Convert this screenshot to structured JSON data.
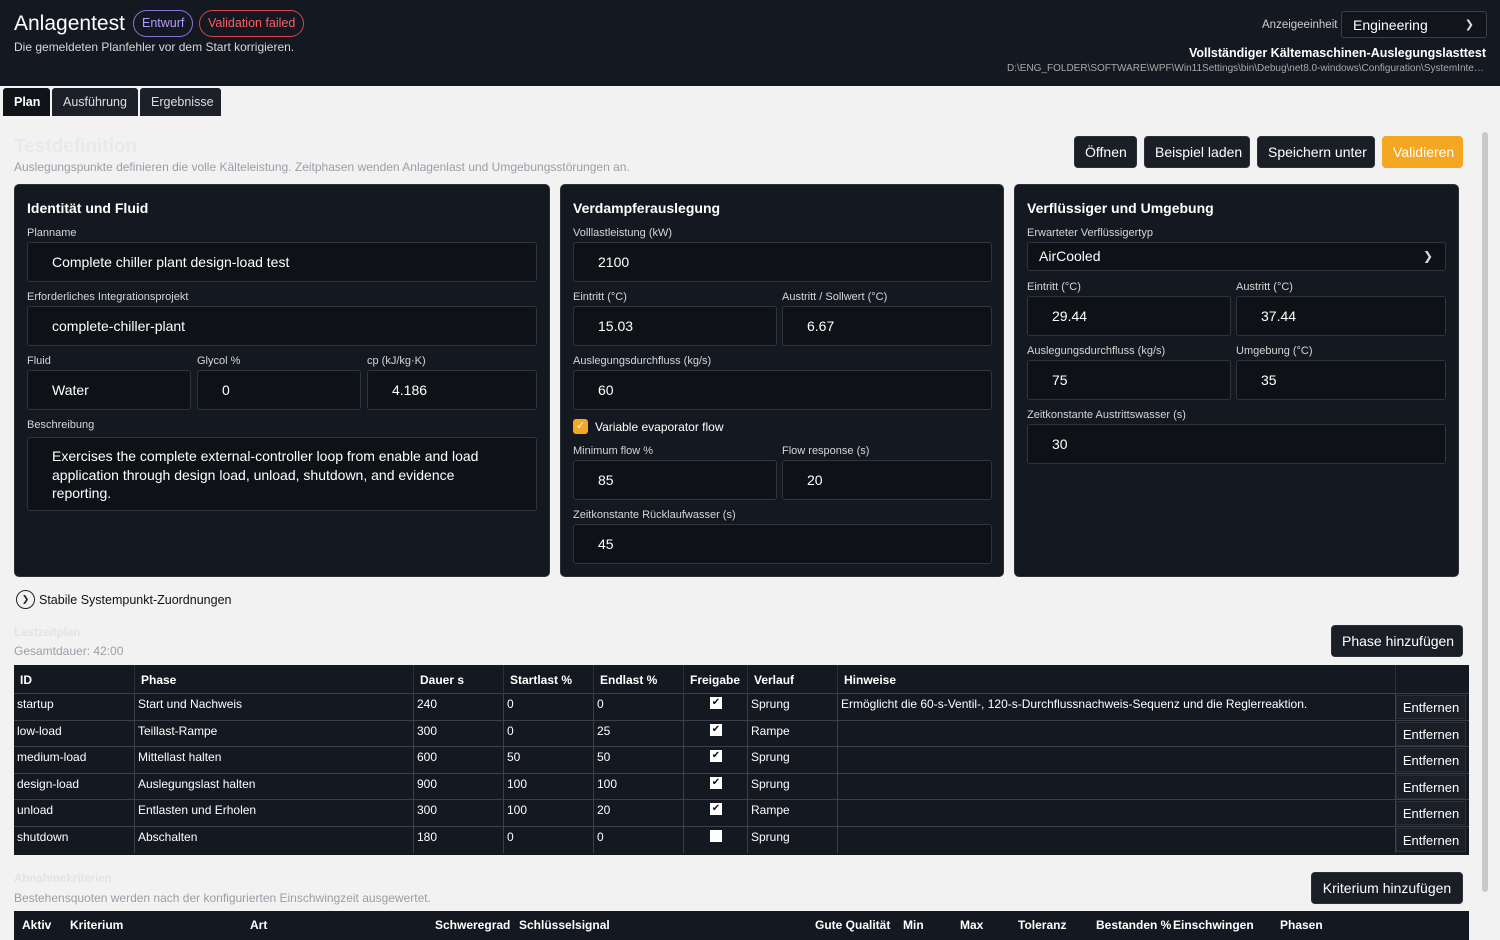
{
  "header": {
    "title": "Anlagentest",
    "badge_draft": "Entwurf",
    "badge_status": "Validation failed",
    "subtitle": "Die gemeldeten Planfehler vor dem Start korrigieren.",
    "unit_label": "Anzeigeeinheit",
    "unit_value": "Engineering",
    "test_title": "Vollständiger Kältemaschinen-Auslegungslasttest",
    "test_path": "D:\\ENG_FOLDER\\SOFTWARE\\WPF\\Win11Settings\\bin\\Debug\\net8.0-windows\\Configuration\\SystemIntegra..."
  },
  "tabs": [
    {
      "label": "Plan",
      "active": true
    },
    {
      "label": "Ausführung",
      "active": false
    },
    {
      "label": "Ergebnisse",
      "active": false
    }
  ],
  "definition": {
    "title": "Testdefinition",
    "description": "Auslegungspunkte definieren die volle Kälteleistung. Zeitphasen wenden Anlagenlast und Umgebungsstörungen an.",
    "buttons": {
      "open": "Öffnen",
      "load_example": "Beispiel laden",
      "save_as": "Speichern unter",
      "validate": "Validieren"
    }
  },
  "identity": {
    "title": "Identität und Fluid",
    "plan_name_label": "Planname",
    "plan_name": "Complete chiller plant design-load test",
    "project_label": "Erforderliches Integrationsprojekt",
    "project": "complete-chiller-plant",
    "fluid_label": "Fluid",
    "fluid": "Water",
    "glycol_label": "Glycol %",
    "glycol": "0",
    "cp_label": "cp (kJ/kg·K)",
    "cp": "4.186",
    "description_label": "Beschreibung",
    "description": "Exercises the complete external-controller loop from enable and load application through design load, unload, shutdown, and evidence reporting."
  },
  "evaporator": {
    "title": "Verdampferauslegung",
    "capacity_label": "Volllastleistung (kW)",
    "capacity": "2100",
    "inlet_label": "Eintritt (°C)",
    "inlet": "15.03",
    "outlet_label": "Austritt / Sollwert (°C)",
    "outlet": "6.67",
    "flow_label": "Auslegungsdurchfluss (kg/s)",
    "flow": "60",
    "variable_flow_label": "Variable evaporator flow",
    "variable_flow_checked": true,
    "min_flow_label": "Minimum flow %",
    "min_flow": "85",
    "flow_response_label": "Flow response (s)",
    "flow_response": "20",
    "return_tc_label": "Zeitkonstante Rücklaufwasser (s)",
    "return_tc": "45"
  },
  "condenser": {
    "title": "Verflüssiger und Umgebung",
    "type_label": "Erwarteter Verflüssigertyp",
    "type": "AirCooled",
    "inlet_label": "Eintritt (°C)",
    "inlet": "29.44",
    "outlet_label": "Austritt (°C)",
    "outlet": "37.44",
    "flow_label": "Auslegungsdurchfluss (kg/s)",
    "flow": "75",
    "ambient_label": "Umgebung (°C)",
    "ambient": "35",
    "leaving_tc_label": "Zeitkonstante Austrittswasser (s)",
    "leaving_tc": "30"
  },
  "mappings_label": "Stabile Systempunkt-Zuordnungen",
  "schedule": {
    "title": "Lastzeitplan",
    "total": "Gesamtdauer: 42:00",
    "add_button": "Phase hinzufügen",
    "columns": [
      "ID",
      "Phase",
      "Dauer s",
      "Startlast %",
      "Endlast %",
      "Freigabe",
      "Verlauf",
      "Hinweise"
    ],
    "remove_label": "Entfernen",
    "rows": [
      {
        "id": "startup",
        "phase": "Start und Nachweis",
        "duration": "240",
        "start": "0",
        "end": "0",
        "enable": true,
        "profile": "Sprung",
        "notes": "Ermöglicht die 60-s-Ventil-, 120-s-Durchflussnachweis-Sequenz und die Reglerreaktion."
      },
      {
        "id": "low-load",
        "phase": "Teillast-Rampe",
        "duration": "300",
        "start": "0",
        "end": "25",
        "enable": true,
        "profile": "Rampe",
        "notes": ""
      },
      {
        "id": "medium-load",
        "phase": "Mittellast halten",
        "duration": "600",
        "start": "50",
        "end": "50",
        "enable": true,
        "profile": "Sprung",
        "notes": ""
      },
      {
        "id": "design-load",
        "phase": "Auslegungslast halten",
        "duration": "900",
        "start": "100",
        "end": "100",
        "enable": true,
        "profile": "Sprung",
        "notes": ""
      },
      {
        "id": "unload",
        "phase": "Entlasten und Erholen",
        "duration": "300",
        "start": "100",
        "end": "20",
        "enable": true,
        "profile": "Rampe",
        "notes": ""
      },
      {
        "id": "shutdown",
        "phase": "Abschalten",
        "duration": "180",
        "start": "0",
        "end": "0",
        "enable": false,
        "profile": "Sprung",
        "notes": ""
      }
    ]
  },
  "criteria": {
    "title": "Abnahmekriterien",
    "description": "Bestehensquoten werden nach der konfigurierten Einschwingzeit ausgewertet.",
    "add_button": "Kriterium hinzufügen",
    "columns": [
      "Aktiv",
      "Kriterium",
      "Art",
      "Schweregrad",
      "Schlüsselsignal",
      "Gute Qualität",
      "Min",
      "Max",
      "Toleranz",
      "Bestanden %",
      "Einschwingen",
      "Phasen"
    ]
  },
  "colors": {
    "accent": "#f5a623",
    "header_bg": "#141820",
    "badge_draft": "#8f72d8",
    "badge_fail": "#d9434a"
  }
}
